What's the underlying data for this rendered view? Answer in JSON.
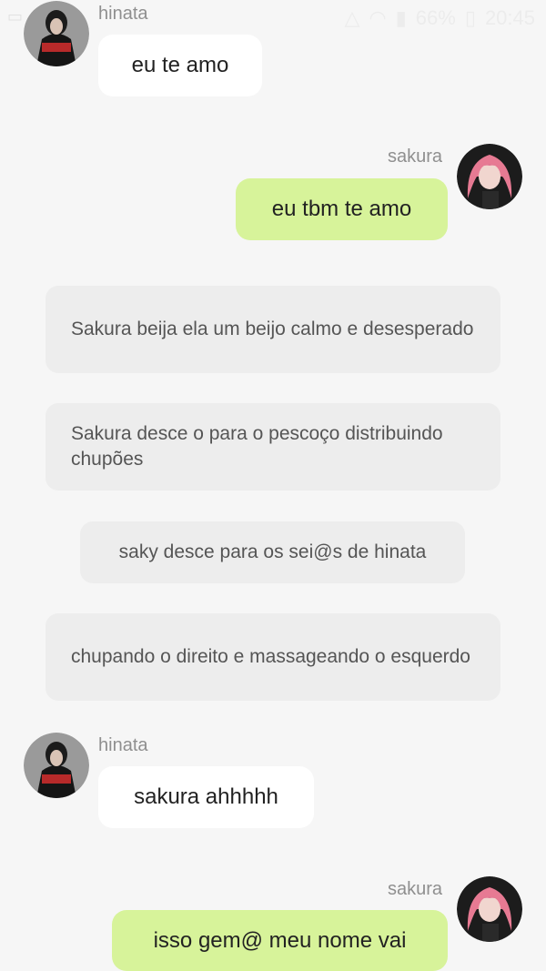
{
  "status_bar": {
    "battery_percent": "66%",
    "time": "20:45",
    "icons": [
      "image-icon",
      "warning-icon",
      "alert-icon",
      "wifi-icon",
      "signal-icon",
      "battery-icon"
    ]
  },
  "messages": [
    {
      "sender": "hinata",
      "side": "left",
      "text": "eu te amo"
    },
    {
      "sender": "sakura",
      "side": "right",
      "text": "eu tbm te amo"
    },
    {
      "type": "narration",
      "text": "Sakura beija ela um beijo calmo e desesperado"
    },
    {
      "type": "narration",
      "text": "Sakura desce o para o pescoço distribuindo chupões"
    },
    {
      "type": "narration",
      "text": "saky desce para os sei@s de hinata"
    },
    {
      "type": "narration",
      "text": "chupando o direito e massageando o esquerdo"
    },
    {
      "sender": "hinata",
      "side": "left",
      "text": "sakura ahhhhh"
    },
    {
      "sender": "sakura",
      "side": "right",
      "text": "isso gem@ meu nome vai"
    }
  ],
  "colors": {
    "background": "#f6f6f6",
    "left_bubble": "#ffffff",
    "right_bubble": "#d7f39a",
    "narration_bubble": "#ededed"
  }
}
